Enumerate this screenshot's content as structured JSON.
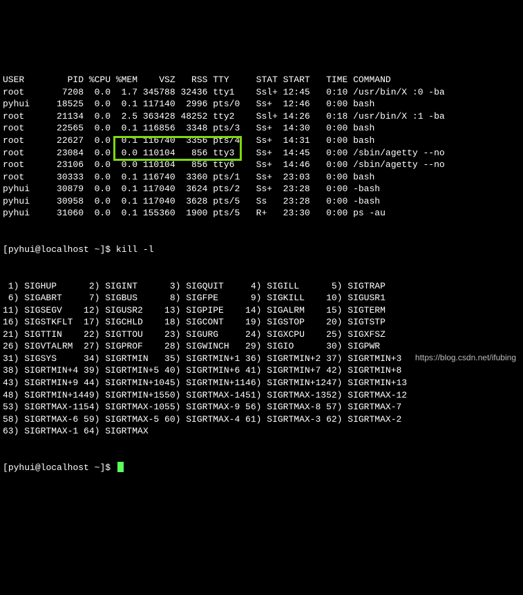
{
  "ps_header": [
    "USER",
    "PID",
    "%CPU",
    "%MEM",
    "VSZ",
    "RSS",
    "TTY",
    "STAT",
    "START",
    "TIME",
    "COMMAND"
  ],
  "ps_rows": [
    {
      "user": "root",
      "pid": 7208,
      "cpu": "0.0",
      "mem": "1.7",
      "vsz": 345788,
      "rss": 32436,
      "tty": "tty1",
      "stat": "Ssl+",
      "start": "12:45",
      "time": "0:10",
      "cmd": "/usr/bin/X :0 -ba"
    },
    {
      "user": "pyhui",
      "pid": 18525,
      "cpu": "0.0",
      "mem": "0.1",
      "vsz": 117140,
      "rss": 2996,
      "tty": "pts/0",
      "stat": "Ss+",
      "start": "12:46",
      "time": "0:00",
      "cmd": "bash"
    },
    {
      "user": "root",
      "pid": 21134,
      "cpu": "0.0",
      "mem": "2.5",
      "vsz": 363428,
      "rss": 48252,
      "tty": "tty2",
      "stat": "Ssl+",
      "start": "14:26",
      "time": "0:18",
      "cmd": "/usr/bin/X :1 -ba"
    },
    {
      "user": "root",
      "pid": 22565,
      "cpu": "0.0",
      "mem": "0.1",
      "vsz": 116856,
      "rss": 3348,
      "tty": "pts/3",
      "stat": "Ss+",
      "start": "14:30",
      "time": "0:00",
      "cmd": "bash"
    },
    {
      "user": "root",
      "pid": 22627,
      "cpu": "0.0",
      "mem": "0.1",
      "vsz": 116740,
      "rss": 3356,
      "tty": "pts/4",
      "stat": "Ss+",
      "start": "14:31",
      "time": "0:00",
      "cmd": "bash"
    },
    {
      "user": "root",
      "pid": 23084,
      "cpu": "0.0",
      "mem": "0.0",
      "vsz": 110104,
      "rss": 856,
      "tty": "tty3",
      "stat": "Ss+",
      "start": "14:45",
      "time": "0:00",
      "cmd": "/sbin/agetty --no"
    },
    {
      "user": "root",
      "pid": 23106,
      "cpu": "0.0",
      "mem": "0.0",
      "vsz": 110104,
      "rss": 856,
      "tty": "tty6",
      "stat": "Ss+",
      "start": "14:46",
      "time": "0:00",
      "cmd": "/sbin/agetty --no"
    },
    {
      "user": "root",
      "pid": 30333,
      "cpu": "0.0",
      "mem": "0.1",
      "vsz": 116740,
      "rss": 3360,
      "tty": "pts/1",
      "stat": "Ss+",
      "start": "23:03",
      "time": "0:00",
      "cmd": "bash"
    },
    {
      "user": "pyhui",
      "pid": 30879,
      "cpu": "0.0",
      "mem": "0.1",
      "vsz": 117040,
      "rss": 3624,
      "tty": "pts/2",
      "stat": "Ss+",
      "start": "23:28",
      "time": "0:00",
      "cmd": "-bash"
    },
    {
      "user": "pyhui",
      "pid": 30958,
      "cpu": "0.0",
      "mem": "0.1",
      "vsz": 117040,
      "rss": 3628,
      "tty": "pts/5",
      "stat": "Ss",
      "start": "23:28",
      "time": "0:00",
      "cmd": "-bash"
    },
    {
      "user": "pyhui",
      "pid": 31060,
      "cpu": "0.0",
      "mem": "0.1",
      "vsz": 155360,
      "rss": 1900,
      "tty": "pts/5",
      "stat": "R+",
      "start": "23:30",
      "time": "0:00",
      "cmd": "ps -au"
    }
  ],
  "prompt1": {
    "user": "pyhui",
    "host": "localhost",
    "dir": "~",
    "cmd": "kill -l"
  },
  "prompt2": {
    "user": "pyhui",
    "host": "localhost",
    "dir": "~",
    "cmd": ""
  },
  "signals": [
    {
      "n": 1,
      "s": "SIGHUP"
    },
    {
      "n": 2,
      "s": "SIGINT"
    },
    {
      "n": 3,
      "s": "SIGQUIT"
    },
    {
      "n": 4,
      "s": "SIGILL"
    },
    {
      "n": 5,
      "s": "SIGTRAP"
    },
    {
      "n": 6,
      "s": "SIGABRT"
    },
    {
      "n": 7,
      "s": "SIGBUS"
    },
    {
      "n": 8,
      "s": "SIGFPE"
    },
    {
      "n": 9,
      "s": "SIGKILL"
    },
    {
      "n": 10,
      "s": "SIGUSR1"
    },
    {
      "n": 11,
      "s": "SIGSEGV"
    },
    {
      "n": 12,
      "s": "SIGUSR2"
    },
    {
      "n": 13,
      "s": "SIGPIPE"
    },
    {
      "n": 14,
      "s": "SIGALRM"
    },
    {
      "n": 15,
      "s": "SIGTERM"
    },
    {
      "n": 16,
      "s": "SIGSTKFLT"
    },
    {
      "n": 17,
      "s": "SIGCHLD"
    },
    {
      "n": 18,
      "s": "SIGCONT"
    },
    {
      "n": 19,
      "s": "SIGSTOP"
    },
    {
      "n": 20,
      "s": "SIGTSTP"
    },
    {
      "n": 21,
      "s": "SIGTTIN"
    },
    {
      "n": 22,
      "s": "SIGTTOU"
    },
    {
      "n": 23,
      "s": "SIGURG"
    },
    {
      "n": 24,
      "s": "SIGXCPU"
    },
    {
      "n": 25,
      "s": "SIGXFSZ"
    },
    {
      "n": 26,
      "s": "SIGVTALRM"
    },
    {
      "n": 27,
      "s": "SIGPROF"
    },
    {
      "n": 28,
      "s": "SIGWINCH"
    },
    {
      "n": 29,
      "s": "SIGIO"
    },
    {
      "n": 30,
      "s": "SIGPWR"
    },
    {
      "n": 31,
      "s": "SIGSYS"
    },
    {
      "n": 34,
      "s": "SIGRTMIN"
    },
    {
      "n": 35,
      "s": "SIGRTMIN+1"
    },
    {
      "n": 36,
      "s": "SIGRTMIN+2"
    },
    {
      "n": 37,
      "s": "SIGRTMIN+3"
    },
    {
      "n": 38,
      "s": "SIGRTMIN+4"
    },
    {
      "n": 39,
      "s": "SIGRTMIN+5"
    },
    {
      "n": 40,
      "s": "SIGRTMIN+6"
    },
    {
      "n": 41,
      "s": "SIGRTMIN+7"
    },
    {
      "n": 42,
      "s": "SIGRTMIN+8"
    },
    {
      "n": 43,
      "s": "SIGRTMIN+9"
    },
    {
      "n": 44,
      "s": "SIGRTMIN+10"
    },
    {
      "n": 45,
      "s": "SIGRTMIN+11"
    },
    {
      "n": 46,
      "s": "SIGRTMIN+12"
    },
    {
      "n": 47,
      "s": "SIGRTMIN+13"
    },
    {
      "n": 48,
      "s": "SIGRTMIN+14"
    },
    {
      "n": 49,
      "s": "SIGRTMIN+15"
    },
    {
      "n": 50,
      "s": "SIGRTMAX-14"
    },
    {
      "n": 51,
      "s": "SIGRTMAX-13"
    },
    {
      "n": 52,
      "s": "SIGRTMAX-12"
    },
    {
      "n": 53,
      "s": "SIGRTMAX-11"
    },
    {
      "n": 54,
      "s": "SIGRTMAX-10"
    },
    {
      "n": 55,
      "s": "SIGRTMAX-9"
    },
    {
      "n": 56,
      "s": "SIGRTMAX-8"
    },
    {
      "n": 57,
      "s": "SIGRTMAX-7"
    },
    {
      "n": 58,
      "s": "SIGRTMAX-6"
    },
    {
      "n": 59,
      "s": "SIGRTMAX-5"
    },
    {
      "n": 60,
      "s": "SIGRTMAX-4"
    },
    {
      "n": 61,
      "s": "SIGRTMAX-3"
    },
    {
      "n": 62,
      "s": "SIGRTMAX-2"
    },
    {
      "n": 63,
      "s": "SIGRTMAX-1"
    },
    {
      "n": 64,
      "s": "SIGRTMAX"
    }
  ],
  "credit": "https://blog.csdn.net/ifubing"
}
